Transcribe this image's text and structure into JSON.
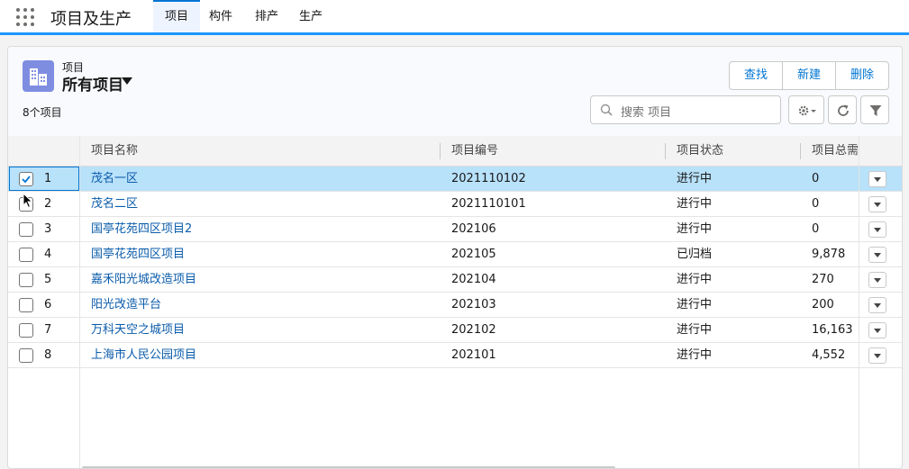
{
  "app": {
    "name": "项目及生产",
    "tabs": [
      {
        "label": "项目",
        "active": true
      },
      {
        "label": "构件",
        "active": false
      },
      {
        "label": "排产",
        "active": false
      },
      {
        "label": "生产",
        "active": false
      }
    ]
  },
  "list_view": {
    "object_label": "项目",
    "view_name": "所有项目",
    "item_count": "8个项目",
    "buttons": {
      "find": "查找",
      "new": "新建",
      "delete": "删除"
    },
    "search_placeholder": "搜索 项目",
    "icons": {
      "object": "building-icon",
      "settings": "gear-icon",
      "refresh": "refresh-icon",
      "filter": "filter-icon"
    }
  },
  "table": {
    "columns": [
      "项目名称",
      "项目编号",
      "项目状态",
      "项目总需"
    ],
    "rows": [
      {
        "num": "1",
        "name": "茂名一区",
        "code": "2021110102",
        "status": "进行中",
        "total": "0",
        "checked": true,
        "selected": true
      },
      {
        "num": "2",
        "name": "茂名二区",
        "code": "2021110101",
        "status": "进行中",
        "total": "0",
        "checked": false,
        "selected": false
      },
      {
        "num": "3",
        "name": "国亭花苑四区项目2",
        "code": "202106",
        "status": "进行中",
        "total": "0",
        "checked": false,
        "selected": false
      },
      {
        "num": "4",
        "name": "国亭花苑四区项目",
        "code": "202105",
        "status": "已归档",
        "total": "9,878",
        "checked": false,
        "selected": false
      },
      {
        "num": "5",
        "name": "嘉禾阳光城改造项目",
        "code": "202104",
        "status": "进行中",
        "total": "270",
        "checked": false,
        "selected": false
      },
      {
        "num": "6",
        "name": "阳光改造平台",
        "code": "202103",
        "status": "进行中",
        "total": "200",
        "checked": false,
        "selected": false
      },
      {
        "num": "7",
        "name": "万科天空之城项目",
        "code": "202102",
        "status": "进行中",
        "total": "16,163",
        "checked": false,
        "selected": false
      },
      {
        "num": "8",
        "name": "上海市人民公园项目",
        "code": "202101",
        "status": "进行中",
        "total": "4,552",
        "checked": false,
        "selected": false
      }
    ]
  },
  "colors": {
    "accent": "#0176d3",
    "link": "#0b5cab",
    "selected_row": "#b8e1fa",
    "object_icon": "#7f8de1"
  }
}
